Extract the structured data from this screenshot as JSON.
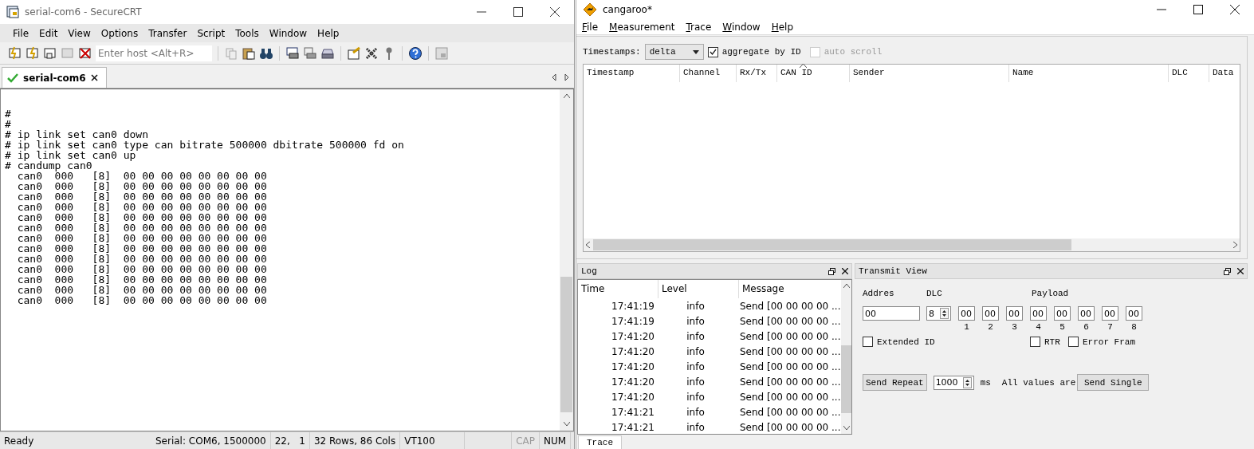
{
  "securecrt": {
    "window": {
      "title": "serial-com6 - SecureCRT"
    },
    "menu": [
      "File",
      "Edit",
      "View",
      "Options",
      "Transfer",
      "Script",
      "Tools",
      "Window",
      "Help"
    ],
    "host_field": {
      "placeholder": "Enter host <Alt+R>"
    },
    "tabs": [
      {
        "label": "serial-com6",
        "selected": true
      }
    ],
    "terminal": {
      "lines": [
        "#",
        "#",
        "# ip link set can0 down",
        "# ip link set can0 type can bitrate 500000 dbitrate 500000 fd on",
        "# ip link set can0 up",
        "# candump can0",
        "  can0  000   [8]  00 00 00 00 00 00 00 00",
        "  can0  000   [8]  00 00 00 00 00 00 00 00",
        "  can0  000   [8]  00 00 00 00 00 00 00 00",
        "  can0  000   [8]  00 00 00 00 00 00 00 00",
        "  can0  000   [8]  00 00 00 00 00 00 00 00",
        "  can0  000   [8]  00 00 00 00 00 00 00 00",
        "  can0  000   [8]  00 00 00 00 00 00 00 00",
        "  can0  000   [8]  00 00 00 00 00 00 00 00",
        "  can0  000   [8]  00 00 00 00 00 00 00 00",
        "  can0  000   [8]  00 00 00 00 00 00 00 00",
        "  can0  000   [8]  00 00 00 00 00 00 00 00",
        "  can0  000   [8]  00 00 00 00 00 00 00 00",
        "  can0  000   [8]  00 00 00 00 00 00 00 00"
      ]
    },
    "status_bar": [
      {
        "text": "Ready",
        "disabled": false
      },
      {
        "text": "Serial: COM6, 1500000",
        "disabled": false
      },
      {
        "text": "22,   1",
        "disabled": false
      },
      {
        "text": "32 Rows, 86 Cols",
        "disabled": false
      },
      {
        "text": "VT100",
        "disabled": false
      },
      {
        "text": "CAP",
        "disabled": true
      },
      {
        "text": "NUM",
        "disabled": false
      }
    ]
  },
  "cangaroo": {
    "window": {
      "title": "cangaroo*"
    },
    "menu": [
      "File",
      "Measurement",
      "Trace",
      "Window",
      "Help"
    ],
    "trace_toolbar": {
      "timestamps_label": "Timestamps:",
      "timestamps_value": "delta",
      "aggregate": {
        "label": "aggregate by ID",
        "checked": true,
        "disabled": false
      },
      "auto_scroll": {
        "label": "auto scroll",
        "checked": false,
        "disabled": true
      }
    },
    "trace_table": {
      "columns": [
        {
          "label": "Timestamp",
          "sorted": false
        },
        {
          "label": "Channel",
          "sorted": false
        },
        {
          "label": "Rx/Tx",
          "sorted": false
        },
        {
          "label": "CAN ID",
          "sorted": true
        },
        {
          "label": "Sender",
          "sorted": false
        },
        {
          "label": "Name",
          "sorted": false
        },
        {
          "label": "DLC",
          "sorted": false
        },
        {
          "label": "Data",
          "sorted": false
        }
      ]
    },
    "log": {
      "title": "Log",
      "columns": [
        "Time",
        "Level",
        "Message"
      ],
      "rows": [
        {
          "time": "17:41:19",
          "level": "info",
          "message": "Send [00 00 00 00 ..."
        },
        {
          "time": "17:41:19",
          "level": "info",
          "message": "Send [00 00 00 00 ..."
        },
        {
          "time": "17:41:20",
          "level": "info",
          "message": "Send [00 00 00 00 ..."
        },
        {
          "time": "17:41:20",
          "level": "info",
          "message": "Send [00 00 00 00 ..."
        },
        {
          "time": "17:41:20",
          "level": "info",
          "message": "Send [00 00 00 00 ..."
        },
        {
          "time": "17:41:20",
          "level": "info",
          "message": "Send [00 00 00 00 ..."
        },
        {
          "time": "17:41:20",
          "level": "info",
          "message": "Send [00 00 00 00 ..."
        },
        {
          "time": "17:41:21",
          "level": "info",
          "message": "Send [00 00 00 00 ..."
        },
        {
          "time": "17:41:21",
          "level": "info",
          "message": "Send [00 00 00 00 ..."
        }
      ]
    },
    "transmit": {
      "title": "Transmit View",
      "address_label": "Addres",
      "address": "00",
      "dlc_label": "DLC",
      "dlc": "8",
      "payload_label": "Payload",
      "payload": [
        {
          "value": "00",
          "index": "1"
        },
        {
          "value": "00",
          "index": "2"
        },
        {
          "value": "00",
          "index": "3"
        },
        {
          "value": "00",
          "index": "4"
        },
        {
          "value": "00",
          "index": "5"
        },
        {
          "value": "00",
          "index": "6"
        },
        {
          "value": "00",
          "index": "7"
        },
        {
          "value": "00",
          "index": "8"
        }
      ],
      "checkboxes": [
        {
          "label": "Extended ID",
          "checked": false
        },
        {
          "label": "RTR",
          "checked": false
        },
        {
          "label": "Error Fram",
          "checked": false
        }
      ],
      "send_repeat": "Send Repeat",
      "interval": "1000",
      "interval_unit": "ms",
      "note": "All values are",
      "send_single": "Send Single"
    },
    "bottom_tabs": [
      {
        "label": "Trace",
        "selected": true
      }
    ]
  }
}
